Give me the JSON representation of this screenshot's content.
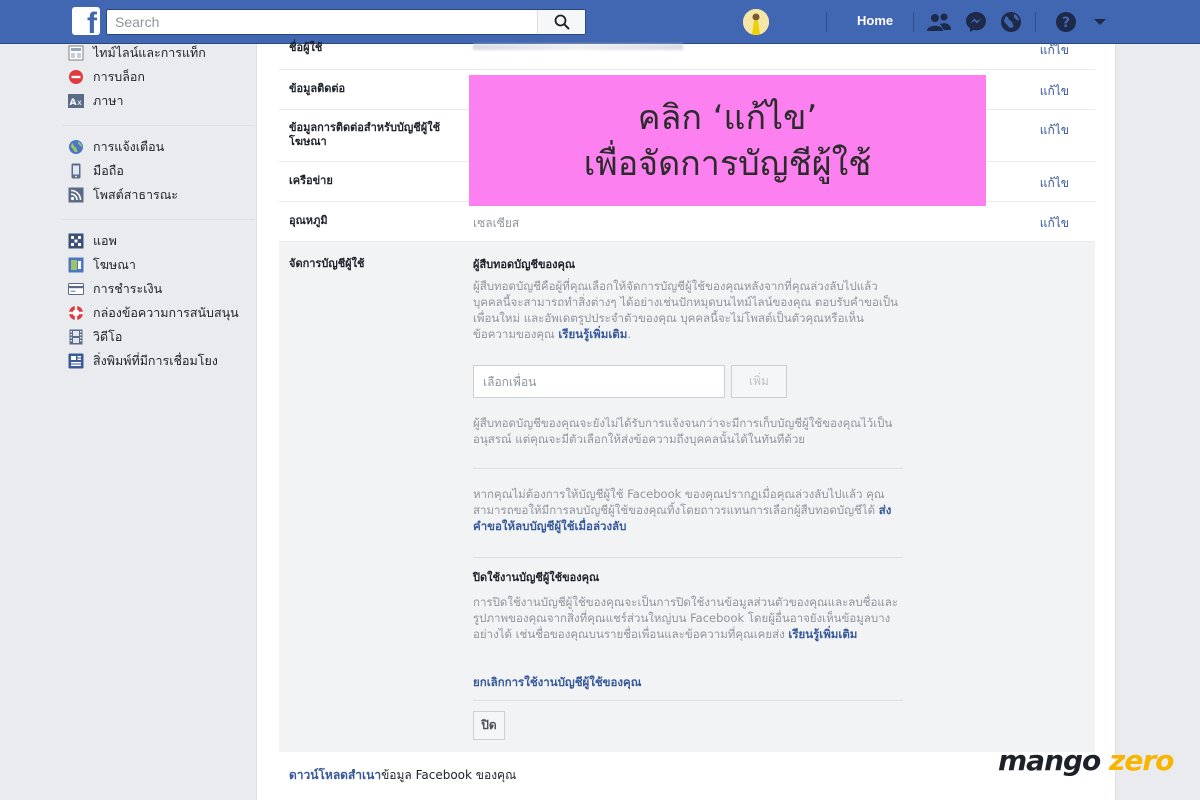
{
  "topbar": {
    "logo": "f",
    "search_placeholder": "Search",
    "home_label": "Home",
    "icons": [
      "search-icon",
      "friends-icon",
      "messenger-icon",
      "globe-icon",
      "help-icon",
      "chevron-down-icon"
    ]
  },
  "sidebar": {
    "group1": [
      {
        "label": "ไทม์ไลน์และการแท็ก",
        "icon": "timeline-icon"
      },
      {
        "label": "การบล็อก",
        "icon": "block-icon"
      },
      {
        "label": "ภาษา",
        "icon": "language-icon"
      }
    ],
    "group2": [
      {
        "label": "การแจ้งเตือน",
        "icon": "globe-icon"
      },
      {
        "label": "มือถือ",
        "icon": "mobile-icon"
      },
      {
        "label": "โพสต์สาธารณะ",
        "icon": "rss-icon"
      }
    ],
    "group3": [
      {
        "label": "แอพ",
        "icon": "apps-icon"
      },
      {
        "label": "โฆษณา",
        "icon": "ads-icon"
      },
      {
        "label": "การชำระเงิน",
        "icon": "payment-icon"
      },
      {
        "label": "กล่องข้อความการสนับสนุน",
        "icon": "support-icon"
      },
      {
        "label": "วิดีโอ",
        "icon": "video-icon"
      },
      {
        "label": "สิ่งพิมพ์ที่มีการเชื่อมโยง",
        "icon": "publications-icon"
      }
    ]
  },
  "settings": {
    "edit_label": "แก้ไข",
    "rows": [
      {
        "label": "ชื่อผู้ใช้",
        "value": ""
      },
      {
        "label": "ข้อมูลติดต่อ",
        "value": ""
      },
      {
        "label": "ข้อมูลการติดต่อสำหรับบัญชีผู้ใช้โฆษณา",
        "value": ""
      },
      {
        "label": "เครือข่าย",
        "value": ""
      },
      {
        "label": "อุณหภูมิ",
        "value": "เซลเซียส"
      }
    ],
    "manage": {
      "label": "จัดการบัญชีผู้ใช้",
      "legacy_title": "ผู้สืบทอดบัญชีของคุณ",
      "legacy_text": "ผู้สืบทอดบัญชีคือผู้ที่คุณเลือกให้จัดการบัญชีผู้ใช้ของคุณหลังจากที่คุณล่วงลับไปแล้ว บุคคลนี้จะสามารถทำสิ่งต่างๆ ได้อย่างเช่นปักหมุดบนไทม์ไลน์ของคุณ ตอบรับคำขอเป็นเพื่อนใหม่ และอัพเดตรูปประจำตัวของคุณ บุคคลนี้จะไม่โพสต์เป็นตัวคุณหรือเห็นข้อความของคุณ",
      "learn_more": "เรียนรู้เพิ่มเติม",
      "friend_placeholder": "เลือกเพื่อน",
      "add_label": "เพิ่ม",
      "legacy_note": "ผู้สืบทอดบัญชีของคุณจะยังไม่ได้รับการแจ้งจนกว่าจะมีการเก็บบัญชีผู้ใช้ของคุณไว้เป็นอนุสรณ์ แต่คุณจะมีตัวเลือกให้ส่งข้อความถึงบุคคลนั้นได้ในทันทีด้วย",
      "delete_text": "หากคุณไม่ต้องการให้บัญชีผู้ใช้ Facebook ของคุณปรากฏเมื่อคุณล่วงลับไปแล้ว คุณสามารถขอให้มีการลบบัญชีผู้ใช้ของคุณทิ้งโดยถาวรแทนการเลือกผู้สืบทอดบัญชีได้",
      "delete_link": "ส่งคำขอให้ลบบัญชีผู้ใช้เมื่อล่วงลับ",
      "deactivate_title": "ปิดใช้งานบัญชีผู้ใช้ของคุณ",
      "deactivate_text": "การปิดใช้งานบัญชีผู้ใช้ของคุณจะเป็นการปิดใช้งานข้อมูลส่วนตัวของคุณและลบชื่อและรูปภาพของคุณจากสิ่งที่คุณแชร์ส่วนใหญ่บน Facebook โดยผู้อื่นอาจยังเห็นข้อมูลบางอย่างได้ เช่นชื่อของคุณบนรายชื่อเพื่อนและข้อความที่คุณเคยส่ง",
      "deactivate_learn_more": "เรียนรู้เพิ่มเติม",
      "deactivate_link": "ยกเลิกการใช้งานบัญชีผู้ใช้ของคุณ",
      "close_label": "ปิด"
    },
    "download_link": "ดาวน์โหลดสำเนา",
    "download_text": "ข้อมูล Facebook ของคุณ"
  },
  "overlay": {
    "line1": "คลิก ‘แก้ไข’",
    "line2": "เพื่อจัดการบัญชีผู้ใช้"
  },
  "watermark": {
    "part1": "mango",
    "part2": "zero"
  },
  "colors": {
    "topbar": "#4267b2",
    "link": "#365899",
    "overlay": "#fd80f0",
    "watermark_accent": "#f7b500"
  }
}
